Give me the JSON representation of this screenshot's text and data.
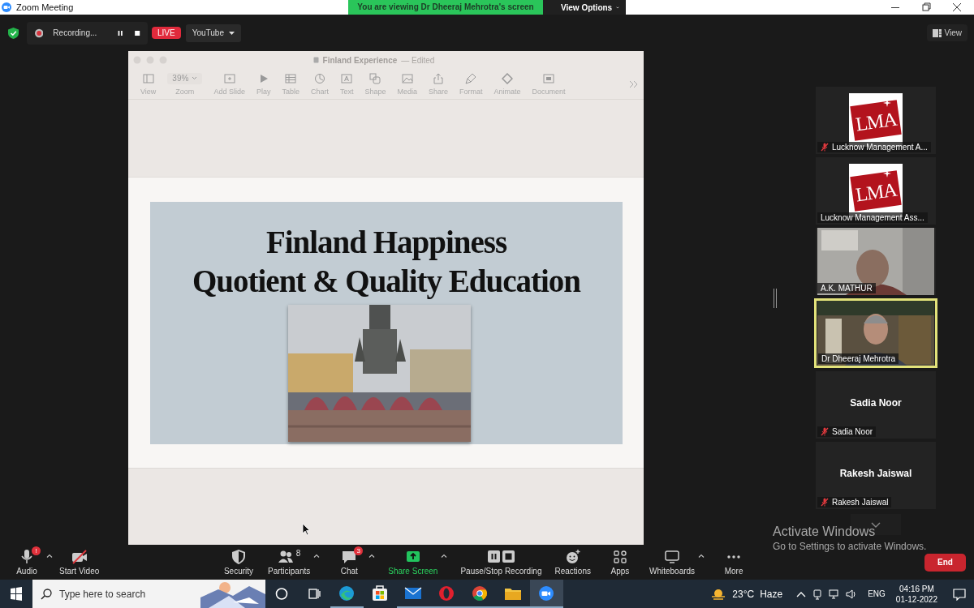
{
  "window": {
    "title": "Zoom Meeting"
  },
  "share_banner": {
    "text": "You are viewing Dr Dheeraj Mehrotra's screen",
    "options_label": "View Options"
  },
  "meeting_bar": {
    "recording_label": "Recording...",
    "live_badge": "LIVE",
    "stream_target": "YouTube",
    "view_label": "View"
  },
  "shared_screen": {
    "document_title": "Finland Experience",
    "document_status": "— Edited",
    "toolbar": [
      {
        "kind": "view",
        "label": "View"
      },
      {
        "kind": "zoom",
        "label": "Zoom",
        "value": "39%"
      },
      {
        "kind": "add-slide",
        "label": "Add Slide"
      },
      {
        "kind": "play",
        "label": "Play"
      },
      {
        "kind": "table",
        "label": "Table"
      },
      {
        "kind": "chart",
        "label": "Chart"
      },
      {
        "kind": "text",
        "label": "Text"
      },
      {
        "kind": "shape",
        "label": "Shape"
      },
      {
        "kind": "media",
        "label": "Media"
      },
      {
        "kind": "share",
        "label": "Share"
      },
      {
        "kind": "format",
        "label": "Format"
      },
      {
        "kind": "animate",
        "label": "Animate"
      },
      {
        "kind": "document",
        "label": "Document"
      }
    ],
    "slide": {
      "title_lines": [
        "Finland Happiness",
        "Quotient & Quality Education"
      ]
    }
  },
  "participants": [
    {
      "kind": "logo",
      "logo_text": "LMA",
      "name": "Lucknow Management A...",
      "muted": true,
      "speaking": false
    },
    {
      "kind": "logo",
      "logo_text": "LMA",
      "name": "Lucknow Management Ass...",
      "muted": false,
      "speaking": false
    },
    {
      "kind": "video",
      "name": "A.K. MATHUR",
      "muted": false,
      "speaking": false
    },
    {
      "kind": "video",
      "name": "Dr Dheeraj Mehrotra",
      "muted": false,
      "speaking": true
    },
    {
      "kind": "name",
      "display_name": "Sadia Noor",
      "name": "Sadia Noor",
      "muted": true,
      "speaking": false
    },
    {
      "kind": "name",
      "display_name": "Rakesh Jaiswal",
      "name": "Rakesh Jaiswal",
      "muted": true,
      "speaking": false
    }
  ],
  "toolbar": {
    "left": [
      {
        "kind": "audio",
        "label": "Audio",
        "badge": "!",
        "has_menu": true
      },
      {
        "kind": "video",
        "label": "Start Video",
        "has_menu": false
      }
    ],
    "center": [
      {
        "kind": "security",
        "label": "Security",
        "has_menu": false
      },
      {
        "kind": "participants",
        "label": "Participants",
        "count": "8",
        "has_menu": true
      },
      {
        "kind": "chat",
        "label": "Chat",
        "badge": "3",
        "has_menu": true
      },
      {
        "kind": "share",
        "label": "Share Screen",
        "has_menu": true
      },
      {
        "kind": "recording",
        "label": "Pause/Stop Recording",
        "has_menu": false
      },
      {
        "kind": "reactions",
        "label": "Reactions",
        "has_menu": false
      },
      {
        "kind": "apps",
        "label": "Apps",
        "has_menu": false
      },
      {
        "kind": "whiteboards",
        "label": "Whiteboards",
        "has_menu": true
      },
      {
        "kind": "more",
        "label": "More",
        "has_menu": false
      }
    ]
  },
  "end_button": "End",
  "activation_notice": {
    "title": "Activate Windows",
    "message": "Go to Settings to activate Windows."
  },
  "taskbar": {
    "search_placeholder": "Type here to search",
    "apps": [
      {
        "kind": "edge",
        "running": true,
        "selected": false
      },
      {
        "kind": "store",
        "running": false,
        "selected": false
      },
      {
        "kind": "mail",
        "running": true,
        "selected": false
      },
      {
        "kind": "opera",
        "running": true,
        "selected": false
      },
      {
        "kind": "chrome",
        "running": true,
        "selected": false
      },
      {
        "kind": "explorer",
        "running": true,
        "selected": false
      },
      {
        "kind": "zoom",
        "running": true,
        "selected": true
      }
    ],
    "temperature": "23°C",
    "weather": "Haze",
    "language": "ENG",
    "time": "04:16 PM",
    "date": "01-12-2022"
  }
}
